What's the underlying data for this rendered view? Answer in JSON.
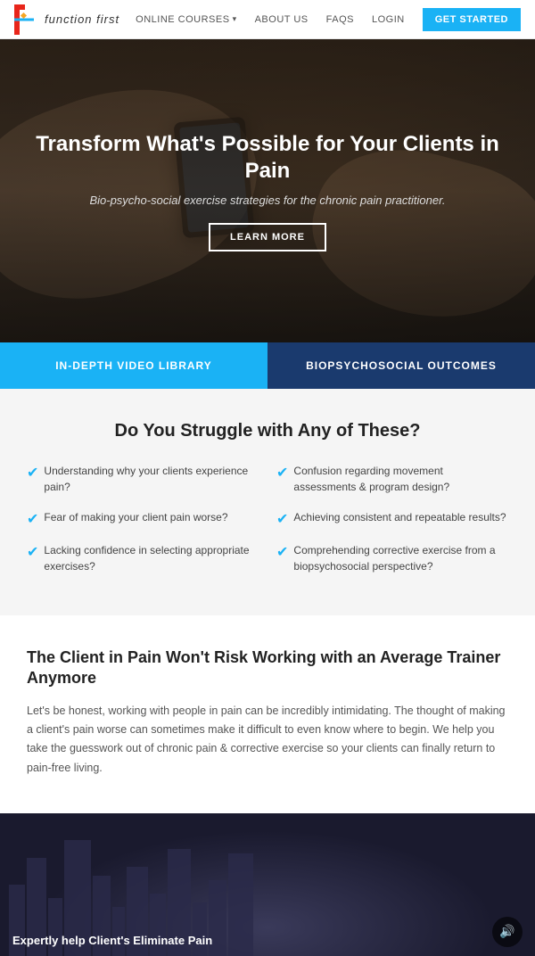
{
  "nav": {
    "logo_text": "function first",
    "links": [
      {
        "label": "ONLINE COURSES",
        "has_caret": true
      },
      {
        "label": "ABOUT US"
      },
      {
        "label": "FAQS"
      },
      {
        "label": "LOGIN"
      }
    ],
    "cta_label": "GET STARTED"
  },
  "hero": {
    "title": "Transform What's Possible for Your Clients in Pain",
    "subtitle": "Bio-psycho-social exercise strategies for the chronic pain practitioner.",
    "cta_label": "LEARN MORE"
  },
  "feature_tabs": [
    {
      "label": "IN-DEPTH VIDEO LIBRARY"
    },
    {
      "label": "BIOPSYCHOSOCIAL OUTCOMES"
    }
  ],
  "struggle": {
    "title": "Do You Struggle with Any of These?",
    "items": [
      {
        "text": "Understanding why your clients experience pain?"
      },
      {
        "text": "Fear of making your client pain worse?"
      },
      {
        "text": "Lacking confidence in selecting appropriate exercises?"
      },
      {
        "text": "Confusion regarding movement assessments & program design?"
      },
      {
        "text": "Achieving consistent and repeatable results?"
      },
      {
        "text": "Comprehending corrective exercise from a biopsychosocial perspective?"
      }
    ]
  },
  "trainer": {
    "title": "The Client in Pain Won't Risk Working with an Average Trainer Anymore",
    "body": "Let's be honest, working with people in pain can be incredibly intimidating. The thought of making a client's pain worse can sometimes make it difficult to even know where to begin. We help you take the guesswork out of chronic pain & corrective exercise so your clients can finally return to pain-free living."
  },
  "video": {
    "caption": "Expertly help Client's Eliminate Pain",
    "sound_icon": "🔊"
  }
}
